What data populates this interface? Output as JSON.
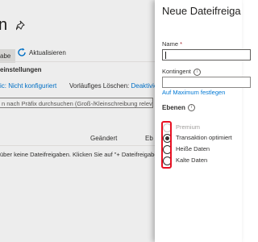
{
  "background": {
    "title": "n",
    "toolbar": {
      "add_label": "abe",
      "refresh_label": "Aktualisieren"
    },
    "section_heading": "einstellungen",
    "line1": {
      "link": "ic: Nicht konfiguriert"
    },
    "line2": {
      "prefix": "Vorläufiges Löschen: ",
      "link": "Deaktivier"
    },
    "filter_placeholder": "n nach Präfix durchsuchen (Groß-/Kleinschreibung relevant",
    "columns": {
      "changed": "Geändert",
      "tier": "Eb"
    },
    "empty_message": "über keine Dateifreigaben. Klicken Sie auf \"+ Dateifreigabe\""
  },
  "panel": {
    "title": "Neue Dateifreiga",
    "name_label": "Name",
    "required_mark": "*",
    "name_value": "",
    "quota_label": "Kontingent",
    "quota_value": "",
    "max_link": "Auf Maximum festlegen",
    "tiers_label": "Ebenen",
    "tiers": [
      {
        "label": "Premium",
        "checked": false,
        "disabled": true
      },
      {
        "label": "Transaktion optimiert",
        "checked": true,
        "disabled": false
      },
      {
        "label": "Heiße Daten",
        "checked": false,
        "disabled": false
      },
      {
        "label": "Kalte Daten",
        "checked": false,
        "disabled": false
      }
    ]
  },
  "colors": {
    "accent": "#0078d4",
    "highlight": "#e81123",
    "required": "#a4262c"
  }
}
